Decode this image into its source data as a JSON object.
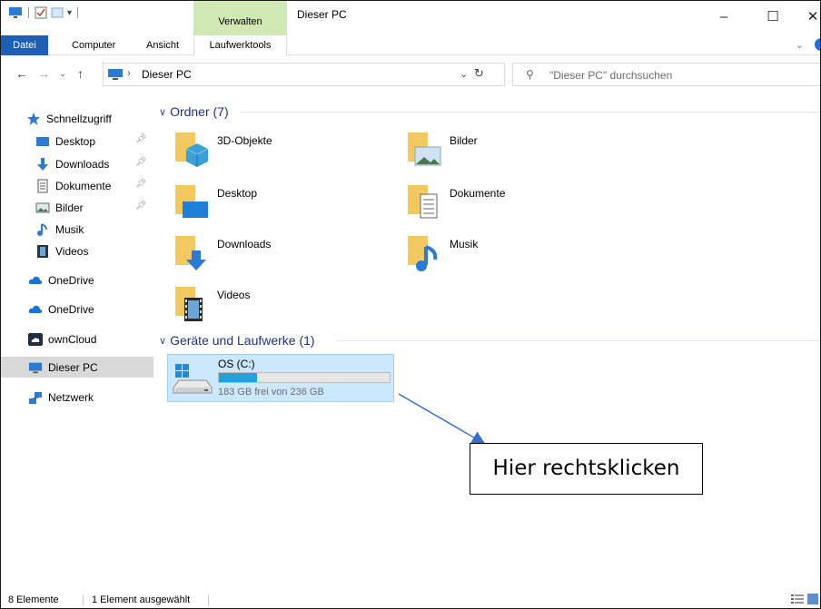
{
  "window": {
    "title": "Dieser PC",
    "context_tab_group": "Verwalten",
    "minimize_symbol": "–",
    "maximize_symbol": "☐",
    "close_symbol": "✕"
  },
  "ribbon": {
    "tabs": [
      "Datei",
      "Computer",
      "Ansicht",
      "Laufwerktools"
    ],
    "collapse_symbol": "⌄"
  },
  "address": {
    "breadcrumb": "Dieser PC",
    "search_placeholder": "\"Dieser PC\" durchsuchen"
  },
  "nav_pane": {
    "items": [
      {
        "label": "Schnellzugriff",
        "icon": "star-icon",
        "pinned": false
      },
      {
        "label": "Desktop",
        "icon": "desktop-icon",
        "pinned": true
      },
      {
        "label": "Downloads",
        "icon": "download-arrow-icon",
        "pinned": true
      },
      {
        "label": "Dokumente",
        "icon": "document-icon",
        "pinned": true
      },
      {
        "label": "Bilder",
        "icon": "pictures-icon",
        "pinned": true
      },
      {
        "label": "Musik",
        "icon": "music-note-icon",
        "pinned": false
      },
      {
        "label": "Videos",
        "icon": "film-icon",
        "pinned": false
      },
      {
        "label": "OneDrive",
        "icon": "cloud-icon",
        "pinned": false
      },
      {
        "label": "OneDrive",
        "icon": "cloud-icon",
        "pinned": false
      },
      {
        "label": "ownCloud",
        "icon": "owncloud-icon",
        "pinned": false
      },
      {
        "label": "Dieser PC",
        "icon": "pc-icon",
        "pinned": false
      },
      {
        "label": "Netzwerk",
        "icon": "network-icon",
        "pinned": false
      }
    ],
    "selected": "Dieser PC"
  },
  "content": {
    "folders_group": "Ordner (7)",
    "folders": [
      "3D-Objekte",
      "Bilder",
      "Desktop",
      "Dokumente",
      "Downloads",
      "Musik",
      "Videos"
    ],
    "drives_group": "Geräte und Laufwerke (1)",
    "drive": {
      "name": "OS (C:)",
      "free_text": "183 GB frei von 236 GB",
      "used_fraction": 0.2246
    }
  },
  "annotation": {
    "callout_text": "Hier rechtsklicken"
  },
  "statusbar": {
    "item_count": "8 Elemente",
    "selection": "1 Element ausgewählt"
  },
  "colors": {
    "file_tab": "#1c5fb5",
    "context_tab": "#cfe8b4",
    "selection_bg": "#cce8ff",
    "group_header": "#1e3287",
    "drive_bar": "#26a0da"
  }
}
